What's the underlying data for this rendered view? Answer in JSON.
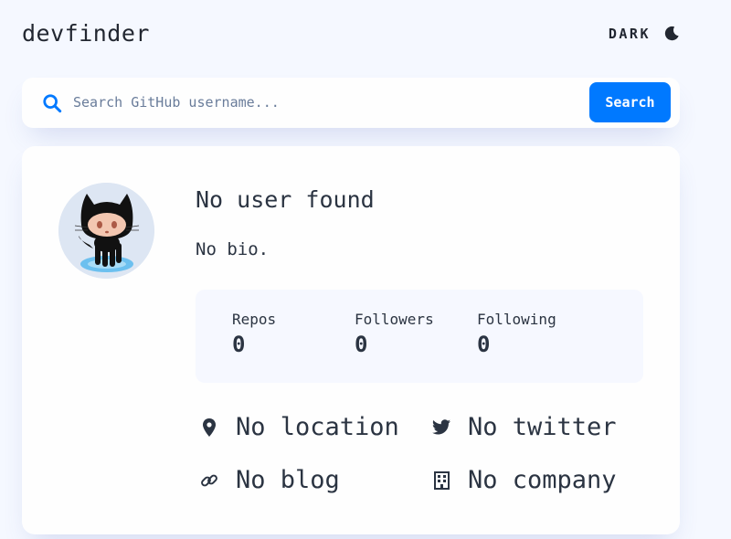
{
  "app": {
    "title": "devfinder"
  },
  "theme_toggle": {
    "label": "DARK",
    "icon": "moon-icon"
  },
  "search": {
    "placeholder": "Search GitHub username...",
    "value": "",
    "button_label": "Search",
    "icon": "search-icon"
  },
  "profile": {
    "name": "No user found",
    "bio": "No bio.",
    "avatar": "github-octocat-avatar",
    "stats": [
      {
        "label": "Repos",
        "value": "0"
      },
      {
        "label": "Followers",
        "value": "0"
      },
      {
        "label": "Following",
        "value": "0"
      }
    ],
    "links": {
      "location": {
        "text": "No location",
        "icon": "location-pin-icon"
      },
      "twitter": {
        "text": "No twitter",
        "icon": "twitter-icon"
      },
      "blog": {
        "text": "No blog",
        "icon": "link-icon"
      },
      "company": {
        "text": "No company",
        "icon": "building-icon"
      }
    }
  },
  "colors": {
    "background": "#f5f8ff",
    "card": "#fefefe",
    "accent": "#0079ff",
    "text": "#2b3442",
    "stats_background": "#f6f8ff"
  }
}
